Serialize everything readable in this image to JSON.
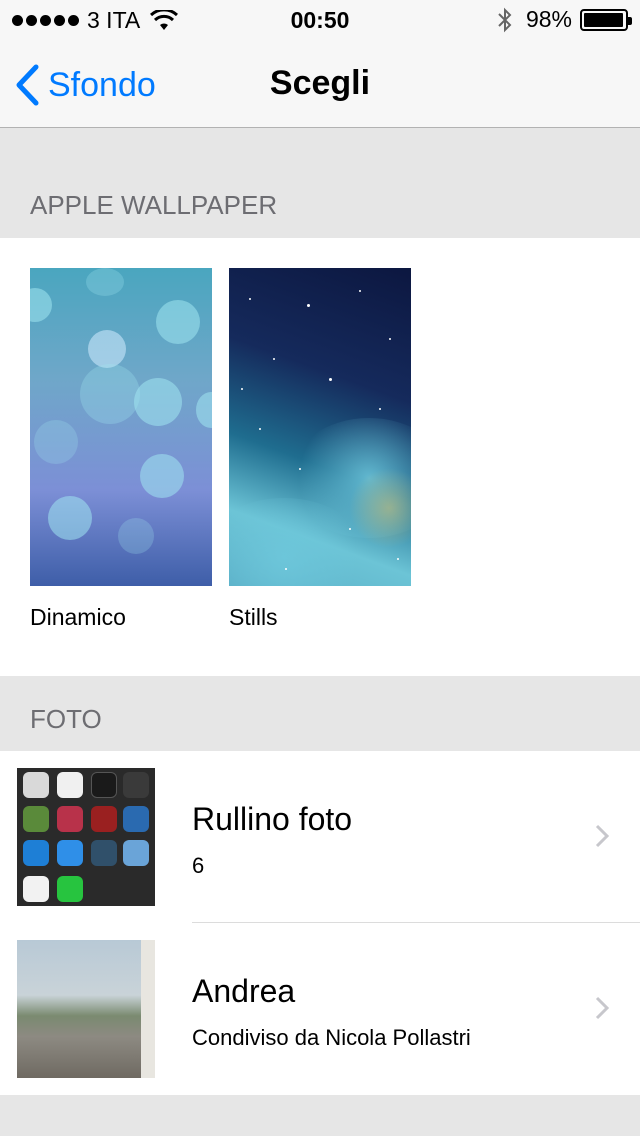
{
  "status_bar": {
    "carrier": "3 ITA",
    "time": "00:50",
    "battery_percent": "98%",
    "battery_level": 0.98,
    "icons": [
      "signal-dots-icon",
      "wifi-icon",
      "bluetooth-icon",
      "battery-icon"
    ]
  },
  "nav": {
    "back_label": "Sfondo",
    "title": "Scegli"
  },
  "sections": {
    "apple": "APPLE WALLPAPER",
    "photos": "FOTO"
  },
  "wallpapers": [
    {
      "label": "Dinamico"
    },
    {
      "label": "Stills"
    }
  ],
  "albums": [
    {
      "title": "Rullino foto",
      "subtitle": "6"
    },
    {
      "title": "Andrea",
      "subtitle": "Condiviso da Nicola Pollastri"
    }
  ],
  "colors": {
    "accent": "#007aff",
    "background": "#e6e6e6"
  }
}
